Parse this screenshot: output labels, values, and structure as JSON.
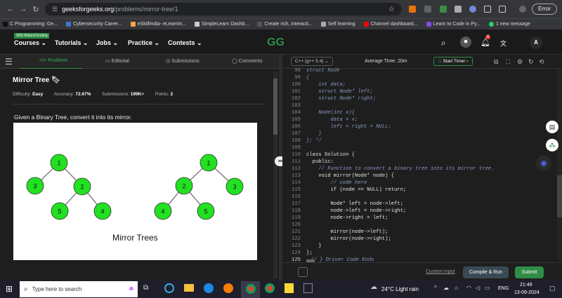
{
  "browser": {
    "url_host": "geeksforgeeks.org",
    "url_path": "/problems/mirror-tree/1",
    "error_label": "Error"
  },
  "bookmarks": [
    "C Programming: Ge...",
    "Cybersecurity Caree...",
    "eSkillIndia- eLearnin...",
    "SimpleLearn Dashb...",
    "Create rich, interacti...",
    "Self learning",
    "Channel dashboard...",
    "Learn to Code in Py...",
    "1 new message"
  ],
  "nav": {
    "promo": "90% Refund Ending",
    "items": [
      "Courses",
      "Tutorials",
      "Jobs",
      "Practice",
      "Contests"
    ],
    "notif_count": "8",
    "avatar": "A",
    "logo": "GG"
  },
  "tabs": [
    "Problem",
    "Editorial",
    "Submissions",
    "Comments"
  ],
  "problem": {
    "title": "Mirror Tree",
    "difficulty_label": "Difficulty:",
    "difficulty": "Easy",
    "accuracy_label": "Accuracy:",
    "accuracy": "72.67%",
    "submissions_label": "Submissions:",
    "submissions": "199K+",
    "points_label": "Points:",
    "points": "2",
    "description": "Given a Binary Tree, convert it into its mirror.",
    "figure_caption": "Mirror Trees"
  },
  "tree_left": [
    {
      "id": "1",
      "v": "1"
    },
    {
      "id": "3",
      "v": "3"
    },
    {
      "id": "2",
      "v": "2"
    },
    {
      "id": "5",
      "v": "5"
    },
    {
      "id": "4",
      "v": "4"
    }
  ],
  "tree_right": [
    {
      "id": "1",
      "v": "1"
    },
    {
      "id": "2",
      "v": "2"
    },
    {
      "id": "3",
      "v": "3"
    },
    {
      "id": "4",
      "v": "4"
    },
    {
      "id": "5",
      "v": "5"
    }
  ],
  "editor": {
    "language": "C++ (g++ 5.4)",
    "avg_time": "Average Time: 20m",
    "timer": "Start Timer"
  },
  "code": [
    {
      "n": "98",
      "t": "struct Node",
      "c": "cm"
    },
    {
      "n": "99",
      "t": "{",
      "c": "cm"
    },
    {
      "n": "100",
      "t": "    int data;",
      "c": "cm"
    },
    {
      "n": "101",
      "t": "    struct Node* left;",
      "c": "cm"
    },
    {
      "n": "102",
      "t": "    struct Node* right;",
      "c": "cm"
    },
    {
      "n": "103",
      "t": "",
      "c": "cm"
    },
    {
      "n": "104",
      "t": "    Node(int x){",
      "c": "cm"
    },
    {
      "n": "105",
      "t": "        data = x;",
      "c": "cm"
    },
    {
      "n": "106",
      "t": "        left = right = NULL;",
      "c": "cm"
    },
    {
      "n": "107",
      "t": "    }",
      "c": "cm"
    },
    {
      "n": "108",
      "t": "}; */",
      "c": "cm"
    },
    {
      "n": "109",
      "t": "",
      "c": "pl"
    },
    {
      "n": "110",
      "t": "class Solution {",
      "c": "pl"
    },
    {
      "n": "111",
      "t": "  public:",
      "c": "pl"
    },
    {
      "n": "112",
      "t": "    // Function to convert a binary tree into its mirror tree.",
      "c": "cm"
    },
    {
      "n": "113",
      "t": "    void mirror(Node* node) {",
      "c": "pl"
    },
    {
      "n": "114",
      "t": "        // code here",
      "c": "cm"
    },
    {
      "n": "115",
      "t": "        if (node == NULL) return;",
      "c": "pl"
    },
    {
      "n": "116",
      "t": "",
      "c": "pl"
    },
    {
      "n": "117",
      "t": "        Node* left = node->left;",
      "c": "pl"
    },
    {
      "n": "118",
      "t": "        node->left = node->right;",
      "c": "pl"
    },
    {
      "n": "119",
      "t": "        node->right = left;",
      "c": "pl"
    },
    {
      "n": "120",
      "t": "",
      "c": "pl"
    },
    {
      "n": "121",
      "t": "        mirror(node->left);",
      "c": "pl"
    },
    {
      "n": "122",
      "t": "        mirror(node->right);",
      "c": "pl"
    },
    {
      "n": "123",
      "t": "    }",
      "c": "pl"
    },
    {
      "n": "124",
      "t": "};",
      "c": "pl"
    },
    {
      "n": "125",
      "t": "// } Driver Code Ends",
      "c": "cm"
    }
  ],
  "footer": {
    "custom_input": "Custom Input",
    "compile": "Compile & Run",
    "submit": "Submit"
  },
  "taskbar": {
    "search_placeholder": "Type here to search",
    "weather": "24°C  Light rain",
    "lang": "ENG",
    "time": "21:49",
    "date": "13-09-2024"
  },
  "colors": {
    "accent": "#2f8d46",
    "node_fill": "#22e022",
    "comment": "#8a9bc4"
  }
}
